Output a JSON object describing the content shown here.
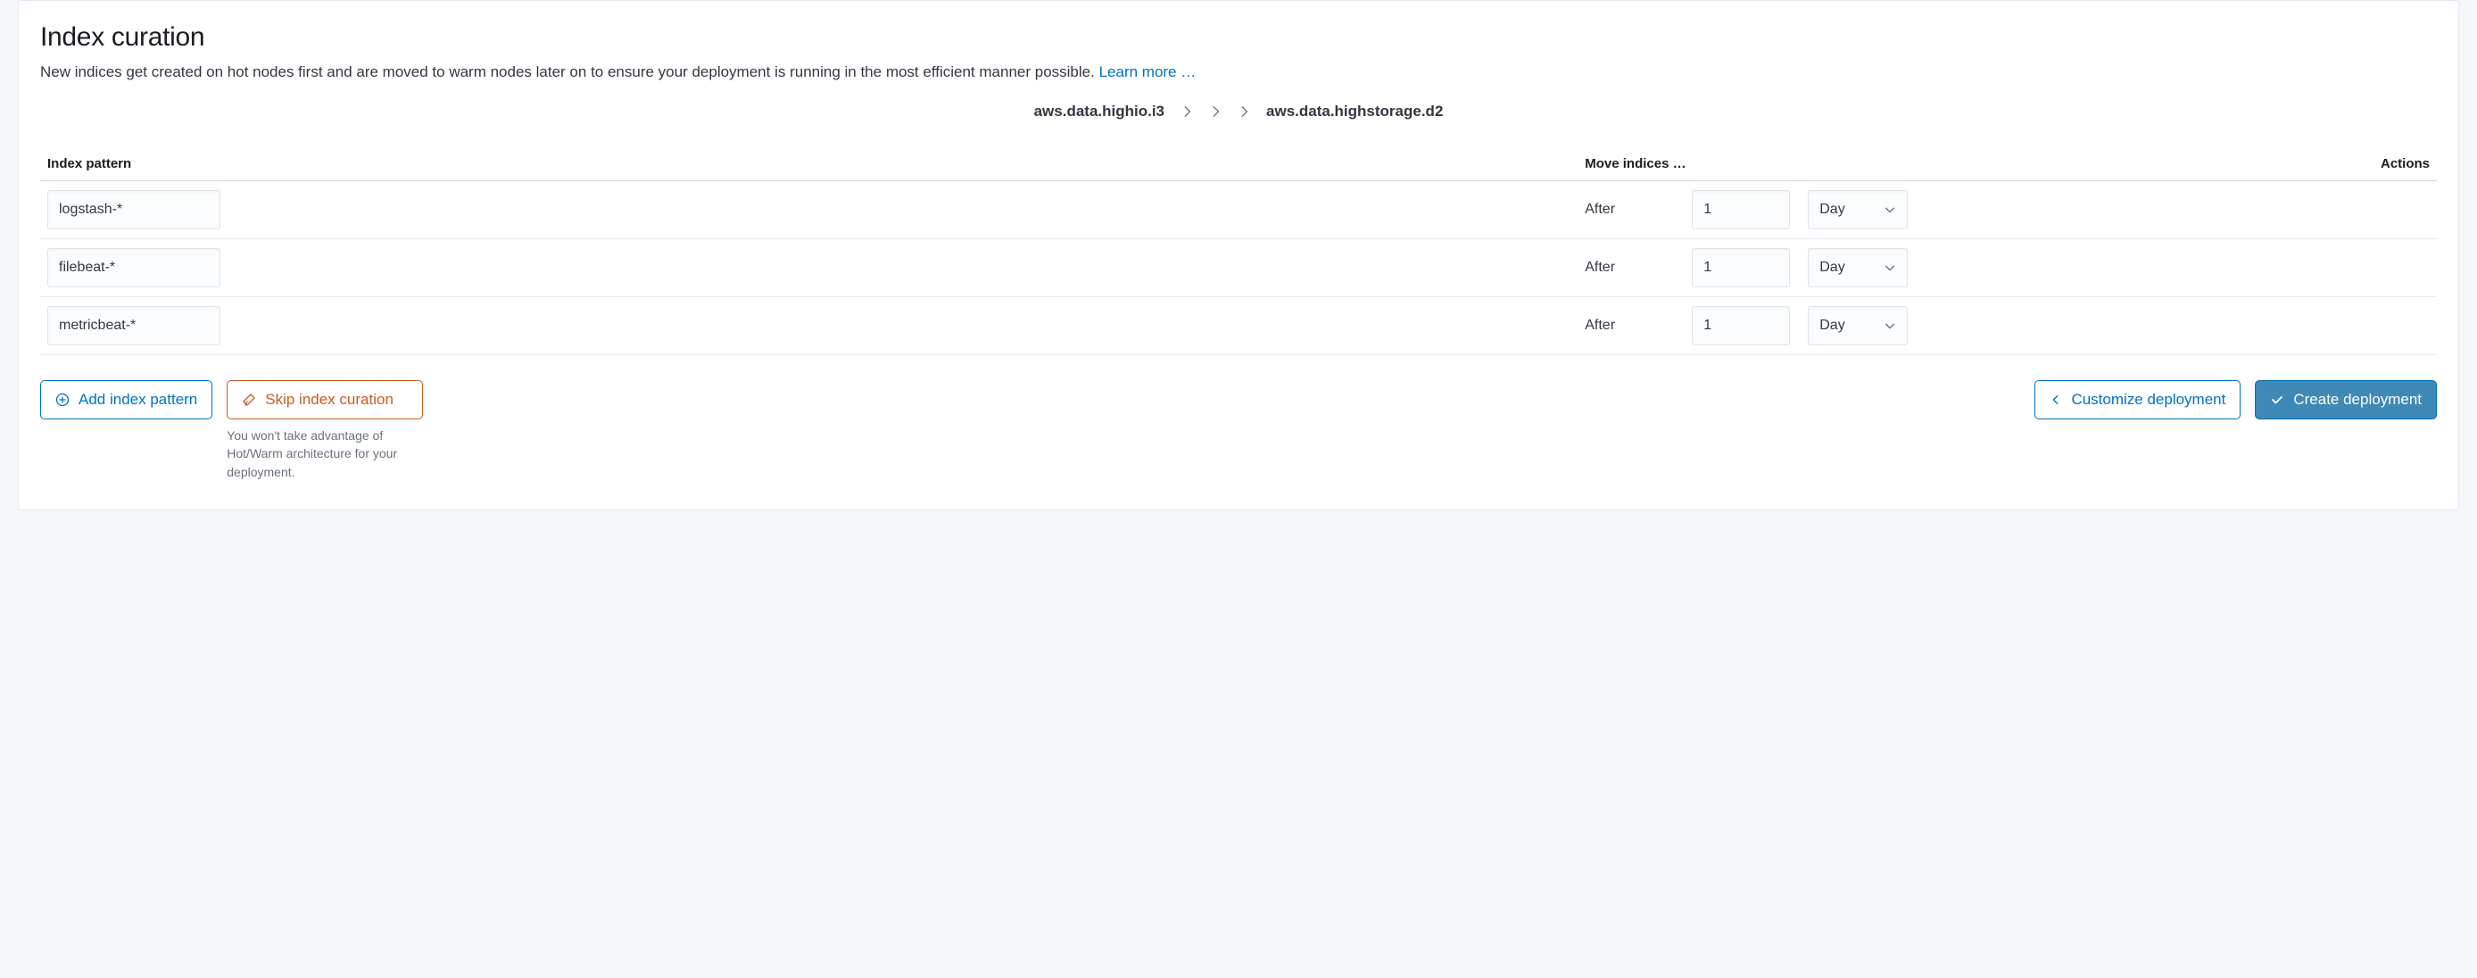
{
  "title": "Index curation",
  "description": "New indices get created on hot nodes first and are moved to warm nodes later on to ensure your deployment is running in the most efficient manner possible. ",
  "learn_more_label": "Learn more …",
  "source_node": "aws.data.highio.i3",
  "dest_node": "aws.data.highstorage.d2",
  "table": {
    "col_pattern": "Index pattern",
    "col_move": "Move indices …",
    "col_actions": "Actions",
    "after_label": "After",
    "rows": [
      {
        "pattern": "logstash-*",
        "num": "1",
        "unit": "Day"
      },
      {
        "pattern": "filebeat-*",
        "num": "1",
        "unit": "Day"
      },
      {
        "pattern": "metricbeat-*",
        "num": "1",
        "unit": "Day"
      }
    ]
  },
  "buttons": {
    "add_pattern": "Add index pattern",
    "skip": "Skip index curation",
    "skip_hint": "You won't take advantage of Hot/Warm architecture for your deployment.",
    "customize": "Customize deployment",
    "create": "Create deployment"
  }
}
